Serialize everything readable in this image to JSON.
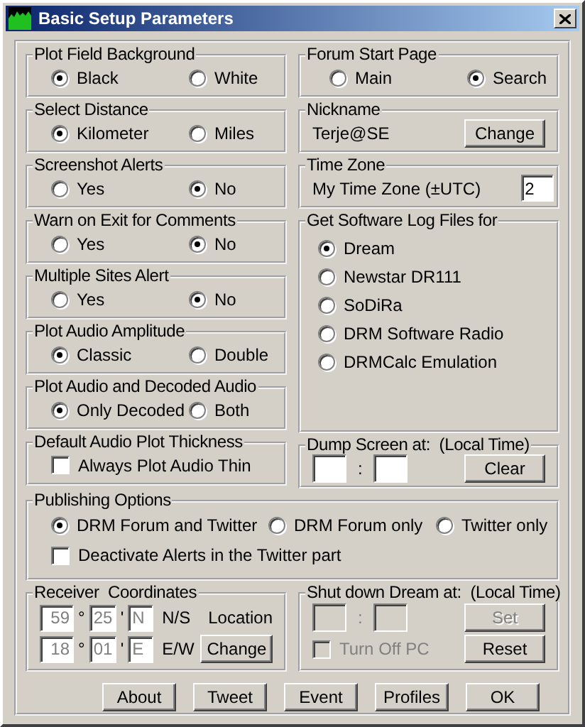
{
  "window": {
    "title": "Basic Setup Parameters"
  },
  "left_groups": [
    {
      "kind": "radio",
      "title": "Plot Field Background",
      "options": [
        {
          "label": "Black",
          "selected": true
        },
        {
          "label": "White",
          "selected": false
        }
      ]
    },
    {
      "kind": "radio",
      "title": "Select Distance",
      "options": [
        {
          "label": "Kilometer",
          "selected": true
        },
        {
          "label": "Miles",
          "selected": false
        }
      ]
    },
    {
      "kind": "radio",
      "title": "Screenshot Alerts",
      "options": [
        {
          "label": "Yes",
          "selected": false
        },
        {
          "label": "No",
          "selected": true
        }
      ]
    },
    {
      "kind": "radio",
      "title": "Warn on Exit for Comments",
      "options": [
        {
          "label": "Yes",
          "selected": false
        },
        {
          "label": "No",
          "selected": true
        }
      ]
    },
    {
      "kind": "radio",
      "title": "Multiple Sites Alert",
      "options": [
        {
          "label": "Yes",
          "selected": false
        },
        {
          "label": "No",
          "selected": true
        }
      ]
    },
    {
      "kind": "radio",
      "title": "Plot Audio Amplitude",
      "options": [
        {
          "label": "Classic",
          "selected": true
        },
        {
          "label": "Double",
          "selected": false
        }
      ]
    },
    {
      "kind": "radio",
      "title": "Plot Audio and Decoded Audio",
      "options": [
        {
          "label": "Only Decoded",
          "selected": true
        },
        {
          "label": "Both",
          "selected": false
        }
      ]
    },
    {
      "kind": "checkbox",
      "title": "Default Audio Plot Thickness",
      "checkbox": {
        "label": "Always Plot Audio Thin",
        "checked": false
      }
    }
  ],
  "forum_start_page": {
    "title": "Forum Start Page",
    "options": [
      {
        "label": "Main",
        "selected": false
      },
      {
        "label": "Search",
        "selected": true
      }
    ]
  },
  "nickname": {
    "title": "Nickname",
    "value": "Terje@SE",
    "button": "Change"
  },
  "time_zone": {
    "title": "Time Zone",
    "label": "My Time Zone (±UTC)",
    "value": "2"
  },
  "log_files": {
    "title": "Get Software Log Files for",
    "options": [
      {
        "label": "Dream",
        "selected": true
      },
      {
        "label": "Newstar DR111",
        "selected": false
      },
      {
        "label": "SoDiRa",
        "selected": false
      },
      {
        "label": "DRM Software Radio",
        "selected": false
      },
      {
        "label": "DRMCalc Emulation",
        "selected": false
      }
    ]
  },
  "dump_screen": {
    "title": "Dump Screen at:  (Local Time)",
    "separator": ":",
    "button": "Clear"
  },
  "publishing": {
    "title": "Publishing Options",
    "options": [
      {
        "label": "DRM Forum and Twitter",
        "selected": true
      },
      {
        "label": "DRM Forum only",
        "selected": false
      },
      {
        "label": "Twitter only",
        "selected": false
      }
    ],
    "checkbox": {
      "label": "Deactivate Alerts in the Twitter part",
      "checked": false
    }
  },
  "receiver": {
    "title": "Receiver  Coordinates",
    "rows": [
      {
        "degrees": "59",
        "degree_mark": "°",
        "minutes": "25",
        "minute_mark": "'",
        "hemisphere": "N",
        "axis": "N/S"
      },
      {
        "degrees": "18",
        "degree_mark": "°",
        "minutes": "01",
        "minute_mark": "'",
        "hemisphere": "E",
        "axis": "E/W"
      }
    ],
    "location_label": "Location",
    "button": "Change"
  },
  "shutdown": {
    "title": "Shut down Dream at:  (Local Time)",
    "separator": ":",
    "time_fields_disabled": true,
    "set_button": {
      "label": "Set",
      "disabled": true
    },
    "checkbox": {
      "label": "Turn Off PC",
      "checked": false,
      "disabled": true
    },
    "reset_button": {
      "label": "Reset",
      "disabled": false
    }
  },
  "buttons": [
    "About",
    "Tweet",
    "Event",
    "Profiles",
    "OK"
  ]
}
